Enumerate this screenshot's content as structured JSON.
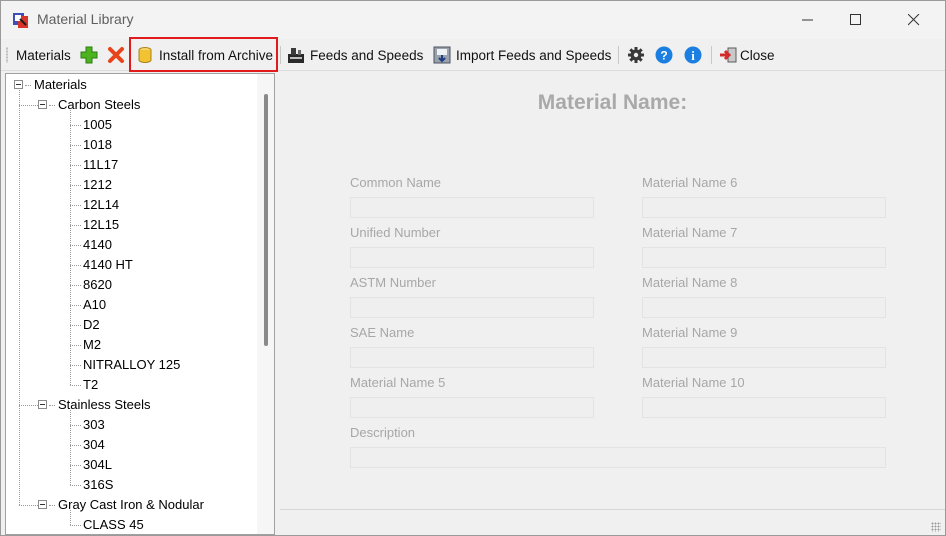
{
  "window": {
    "title": "Material Library"
  },
  "toolbar": {
    "materials_label": "Materials",
    "install_label": "Install from Archive",
    "feeds_label": "Feeds and Speeds",
    "import_label": "Import Feeds and Speeds",
    "close_label": "Close",
    "highlight_color": "#e11b1b"
  },
  "tree": {
    "root": "Materials",
    "groups": [
      {
        "label": "Carbon Steels",
        "items": [
          "1005",
          "1018",
          "11L17",
          "1212",
          "12L14",
          "12L15",
          "4140",
          "4140 HT",
          "8620",
          "A10",
          "D2",
          "M2",
          "NITRALLOY 125",
          "T2"
        ]
      },
      {
        "label": "Stainless Steels",
        "items": [
          "303",
          "304",
          "304L",
          "316S"
        ]
      },
      {
        "label": "Gray Cast Iron & Nodular",
        "items": [
          "CLASS 45"
        ]
      }
    ]
  },
  "form": {
    "title": "Material Name:",
    "left_fields": [
      "Common Name",
      "Unified Number",
      "ASTM Number",
      "SAE Name",
      "Material Name 5"
    ],
    "right_fields": [
      "Material Name 6",
      "Material Name 7",
      "Material Name 8",
      "Material Name 9",
      "Material Name 10"
    ],
    "description_label": "Description"
  }
}
